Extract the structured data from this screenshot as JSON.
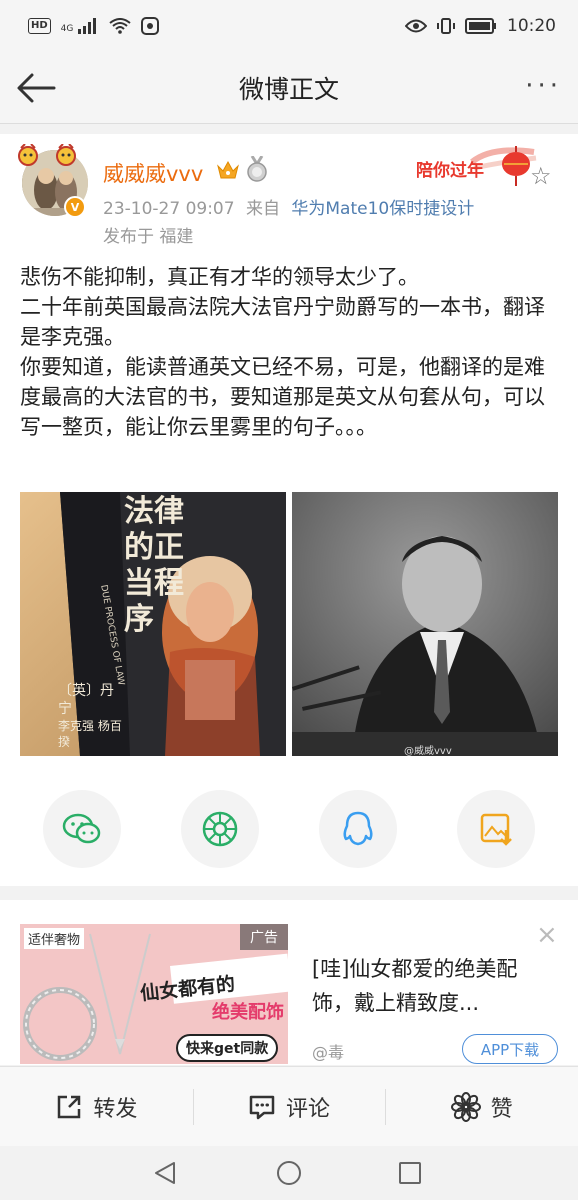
{
  "status": {
    "hd": "HD",
    "signal": "4G",
    "time": "10:20"
  },
  "header": {
    "title": "微博正文",
    "more": "···"
  },
  "post": {
    "username": "威威威vvv",
    "timestamp": "23-10-27 09:07",
    "from_label": "来自",
    "device": "华为Mate10保时捷设计",
    "location": "发布于 福建",
    "festival_text": "陪你过年",
    "paragraphs": [
      "悲伤不能抑制，真正有才华的领导太少了。",
      "二十年前英国最高法院大法官丹宁勋爵写的一本书，翻译是李克强。",
      "你要知道，能读普通英文已经不易，可是，他翻译的是难度最高的大法官的书，要知道那是英文从句套从句，可以写一整页，能让你云里雾里的句子。。。"
    ],
    "book_title": "法律的正当程序",
    "book_subtitle": "DUE PROCESS OF LAW",
    "book_author": "〔英〕丹宁",
    "book_translators": "李克强 杨百揆",
    "watermark": "@威威vvv"
  },
  "share": [
    {
      "name": "wechat",
      "color": "#2aae67"
    },
    {
      "name": "moments",
      "color": "#2aae67"
    },
    {
      "name": "qq",
      "color": "#3a9ef0"
    },
    {
      "name": "save-image",
      "color": "#f0a51e"
    }
  ],
  "ad": {
    "label": "广告",
    "tag": "适伴奢物",
    "img_line1": "仙女都有的",
    "img_line2": "绝美配饰",
    "img_button": "快来get同款",
    "title": "[哇]仙女都爱的绝美配饰，戴上精致度...",
    "source": "@毒",
    "app_button": "APP下载",
    "close": "×"
  },
  "bottom": {
    "repost": "转发",
    "comment": "评论",
    "like": "赞"
  },
  "colors": {
    "username": "#eb6b0e",
    "device": "#507daf",
    "accent_blue": "#4f8fd9"
  }
}
